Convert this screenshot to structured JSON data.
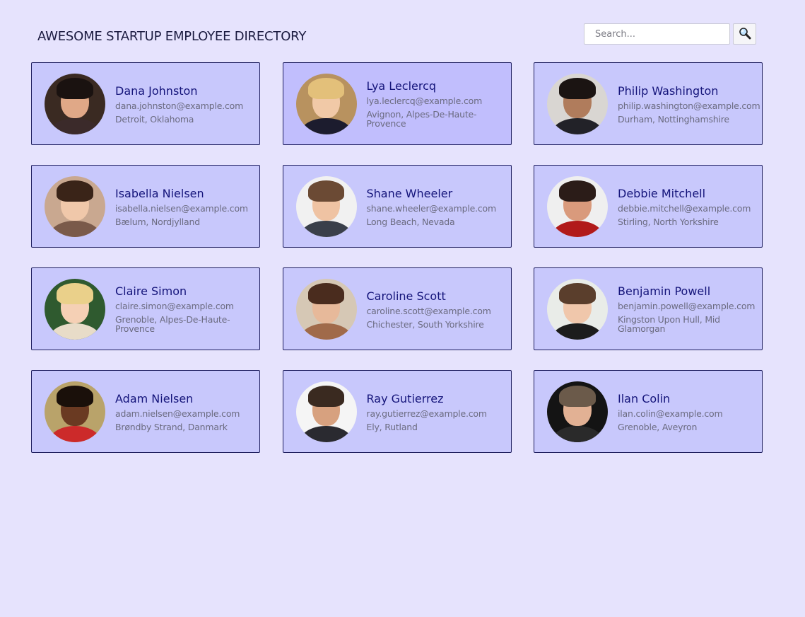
{
  "header": {
    "title": "AWESOME STARTUP EMPLOYEE DIRECTORY"
  },
  "search": {
    "placeholder": "Search...",
    "value": "",
    "button_icon": "magnifier-icon"
  },
  "employees": [
    {
      "name": "Dana Johnston",
      "email": "dana.johnston@example.com",
      "location": "Detroit, Oklahoma",
      "avatar": {
        "bg": "#3a2a22",
        "skin": "#e0a887",
        "hair": "#1a1210",
        "shirt": "#3b2a2a"
      }
    },
    {
      "name": "Lya Leclercq",
      "email": "lya.leclercq@example.com",
      "location": "Avignon, Alpes-De-Haute-Provence",
      "avatar": {
        "bg": "#b8925f",
        "skin": "#f1c9a7",
        "hair": "#e3c07a",
        "shirt": "#1c1c2e"
      }
    },
    {
      "name": "Philip Washington",
      "email": "philip.washington@example.com",
      "location": "Durham, Nottinghamshire",
      "avatar": {
        "bg": "#d9d6d2",
        "skin": "#b07c5c",
        "hair": "#1b1412",
        "shirt": "#222228"
      }
    },
    {
      "name": "Isabella Nielsen",
      "email": "isabella.nielsen@example.com",
      "location": "Bælum, Nordjylland",
      "avatar": {
        "bg": "#c9a890",
        "skin": "#f0c8aa",
        "hair": "#3a2418",
        "shirt": "#7a5a4a"
      }
    },
    {
      "name": "Shane Wheeler",
      "email": "shane.wheeler@example.com",
      "location": "Long Beach, Nevada",
      "avatar": {
        "bg": "#f1f1f1",
        "skin": "#efc3a3",
        "hair": "#6b4a34",
        "shirt": "#3a3f4a"
      }
    },
    {
      "name": "Debbie Mitchell",
      "email": "debbie.mitchell@example.com",
      "location": "Stirling, North Yorkshire",
      "avatar": {
        "bg": "#efefef",
        "skin": "#d99a7c",
        "hair": "#2b1c18",
        "shirt": "#b11a1a"
      }
    },
    {
      "name": "Claire Simon",
      "email": "claire.simon@example.com",
      "location": "Grenoble, Alpes-De-Haute-Provence",
      "avatar": {
        "bg": "#2f5a2f",
        "skin": "#f5d0b5",
        "hair": "#ead08a",
        "shirt": "#e8dcc8"
      }
    },
    {
      "name": "Caroline Scott",
      "email": "caroline.scott@example.com",
      "location": "Chichester, South Yorkshire",
      "avatar": {
        "bg": "#d6c8b5",
        "skin": "#e7b99a",
        "hair": "#4a2c1e",
        "shirt": "#a06a4a"
      }
    },
    {
      "name": "Benjamin Powell",
      "email": "benjamin.powell@example.com",
      "location": "Kingston Upon Hull, Mid Glamorgan",
      "avatar": {
        "bg": "#e9ece8",
        "skin": "#f0c7ab",
        "hair": "#5a3e2c",
        "shirt": "#1c1c1c"
      }
    },
    {
      "name": "Adam Nielsen",
      "email": "adam.nielsen@example.com",
      "location": "Brøndby Strand, Danmark",
      "avatar": {
        "bg": "#b9a36a",
        "skin": "#6a3a22",
        "hair": "#1a100a",
        "shirt": "#cc2a2a"
      }
    },
    {
      "name": "Ray Gutierrez",
      "email": "ray.gutierrez@example.com",
      "location": "Ely, Rutland",
      "avatar": {
        "bg": "#f5f5f5",
        "skin": "#d7a17f",
        "hair": "#3a2a20",
        "shirt": "#2a2a30"
      }
    },
    {
      "name": "Ilan Colin",
      "email": "ilan.colin@example.com",
      "location": "Grenoble, Aveyron",
      "avatar": {
        "bg": "#141414",
        "skin": "#e2b194",
        "hair": "#6b5a4a",
        "shirt": "#2a2a2a"
      }
    }
  ]
}
